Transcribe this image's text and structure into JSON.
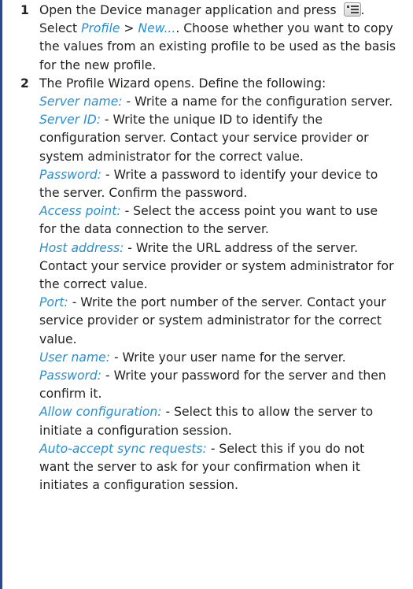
{
  "steps": [
    {
      "number": "1",
      "line1_a": "Open the Device manager application and press",
      "line1_b": ".",
      "menu_icon": "options-menu-icon",
      "line2_a": "Select",
      "line2_profile": "Profile",
      "line2_sep": ">",
      "line2_new": "New...",
      "line2_b": ". Choose whether you want to",
      "rest": "copy the values from an existing profile to be used as the basis for the new profile."
    },
    {
      "number": "2",
      "intro": "The Profile Wizard opens. Define the following:",
      "fields": [
        {
          "term": "Server name:",
          "desc": " - Write a name for the configuration server."
        },
        {
          "term": "Server ID:",
          "desc": " - Write the unique ID to identify the configuration server. Contact your service provider or system administrator for the correct value."
        },
        {
          "term": "Password:",
          "desc": " - Write a password to identify your device to the server. Confirm the password."
        },
        {
          "term": "Access point:",
          "desc": " - Select the access point you want to use for the data connection to the server."
        },
        {
          "term": "Host address:",
          "desc": " - Write the URL address of the server. Contact your service provider or system administrator for the correct value."
        },
        {
          "term": "Port:",
          "desc": " - Write the port number of the server. Contact your service provider or system administrator for the correct value."
        },
        {
          "term": "User name:",
          "desc": " - Write your user name for the server."
        },
        {
          "term": "Password:",
          "desc": " - Write your password for the server and then confirm it."
        },
        {
          "term": "Allow configuration:",
          "desc": " - Select this to allow the server to initiate a configuration session."
        },
        {
          "term": "Auto-accept sync requests:",
          "desc": " - Select this if you do not want the server to ask for your confirmation when it initiates a configuration session."
        }
      ]
    }
  ],
  "colors": {
    "emphasis": "#2a8fd0",
    "edge_bar": "#2f4a8c",
    "text": "#222222"
  }
}
